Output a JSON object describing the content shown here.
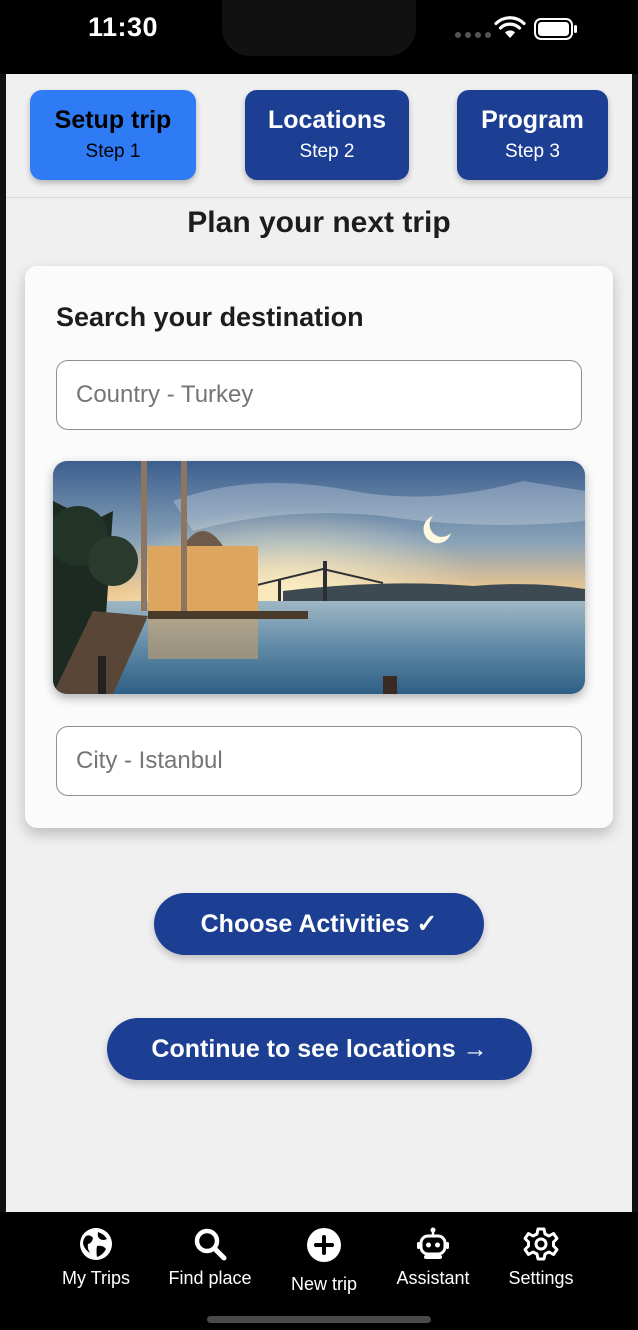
{
  "status_bar": {
    "time": "11:30",
    "icons": [
      "cellular-dots-icon",
      "wifi-icon",
      "battery-icon"
    ]
  },
  "stepper": {
    "steps": [
      {
        "title": "Setup trip",
        "subtitle": "Step 1",
        "active": true
      },
      {
        "title": "Locations",
        "subtitle": "Step 2",
        "active": false
      },
      {
        "title": "Program",
        "subtitle": "Step 3",
        "active": false
      }
    ]
  },
  "page": {
    "title": "Plan your next trip"
  },
  "search_card": {
    "heading": "Search your destination",
    "country_field": {
      "placeholder": "Country - Turkey",
      "value": ""
    },
    "city_field": {
      "placeholder": "City - Istanbul",
      "value": ""
    },
    "image": "istanbul-mosque-bosphorus-photo"
  },
  "actions": {
    "choose_activities": "Choose Activities ✓",
    "continue": "Continue to see locations →"
  },
  "tab_bar": {
    "items": [
      {
        "label": "My Trips",
        "icon": "globe-icon"
      },
      {
        "label": "Find place",
        "icon": "search-icon"
      },
      {
        "label": "New trip",
        "icon": "plus-circle-icon"
      },
      {
        "label": "Assistant",
        "icon": "robot-icon"
      },
      {
        "label": "Settings",
        "icon": "gear-icon"
      }
    ]
  },
  "colors": {
    "primary": "#1c3f94",
    "active_step": "#2f7bf5",
    "background": "#f0f0f1",
    "card": "#fbfbfb"
  }
}
